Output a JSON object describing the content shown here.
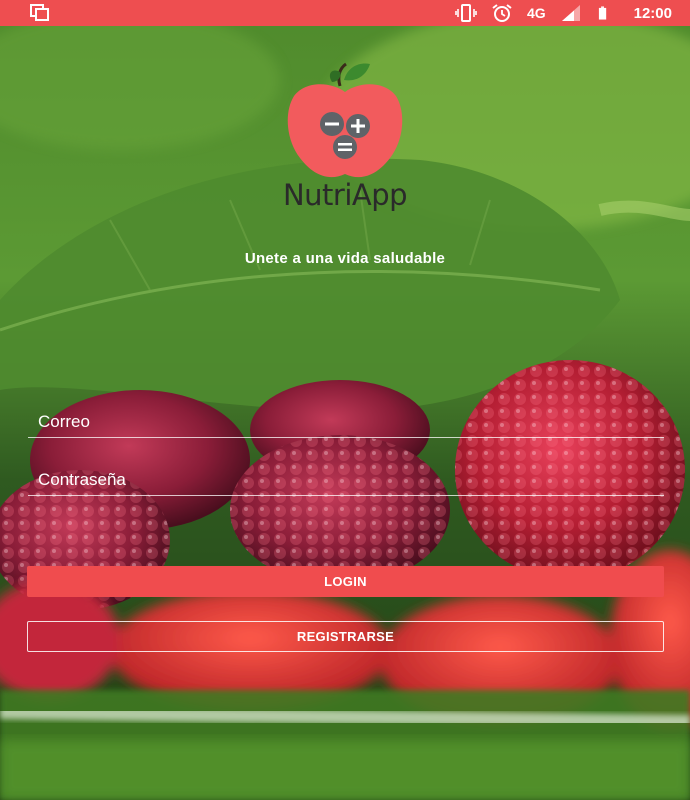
{
  "status_bar": {
    "network": "4G",
    "time": "12:00",
    "icons": [
      "recent-apps-icon",
      "vibrate-icon",
      "alarm-icon",
      "signal-icon",
      "battery-icon"
    ]
  },
  "app": {
    "name": "NutriApp",
    "tagline": "Unete a una vida saludable"
  },
  "form": {
    "email_placeholder": "Correo",
    "password_placeholder": "Contraseña",
    "login_label": "LOGIN",
    "register_label": "REGISTRARSE"
  },
  "colors": {
    "accent": "#f04c4e",
    "status_bar": "#ee4e50",
    "logo_apple": "#f25b5d",
    "logo_leaf": "#3c8a2e"
  }
}
